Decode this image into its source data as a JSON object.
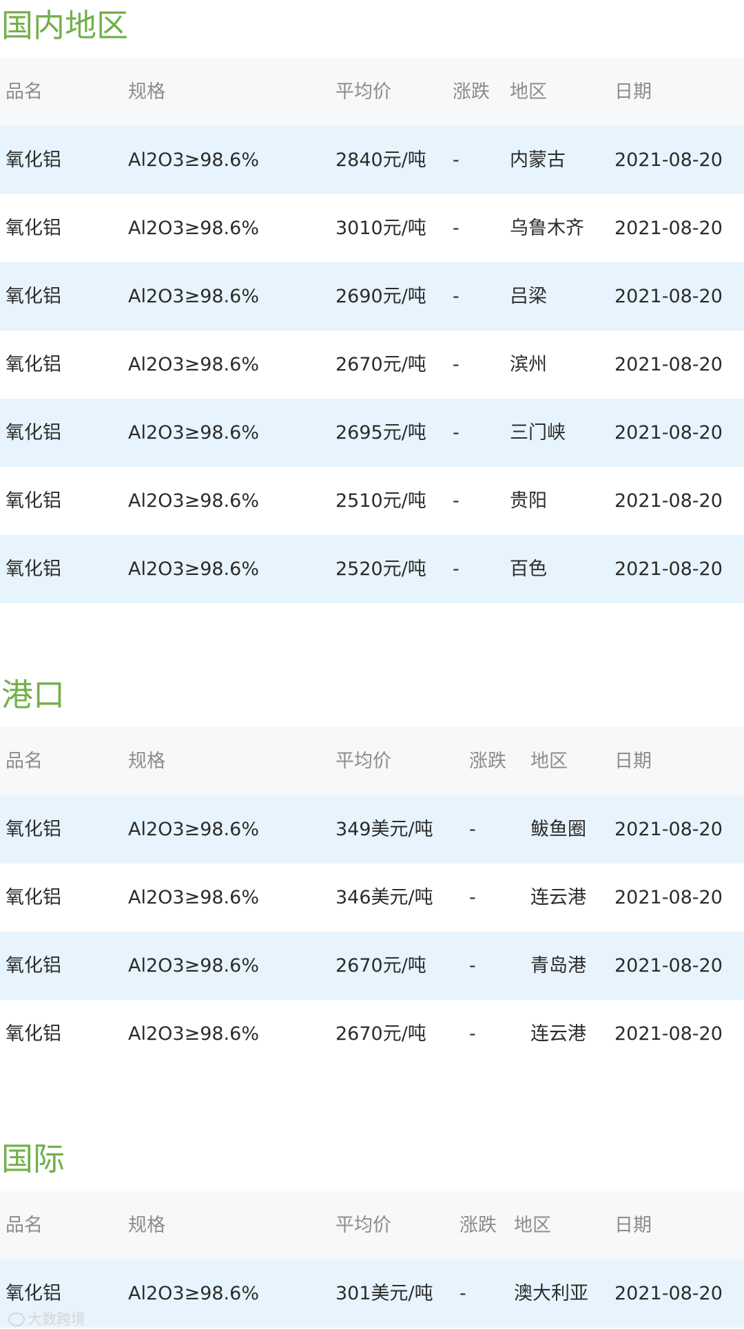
{
  "sections": [
    {
      "title": "国内地区",
      "headers": [
        "品名",
        "规格",
        "平均价",
        "涨跌",
        "地区",
        "日期"
      ],
      "rows": [
        [
          "氧化铝",
          "Al2O3≥98.6%",
          "2840元/吨",
          "-",
          "内蒙古",
          "2021-08-20"
        ],
        [
          "氧化铝",
          "Al2O3≥98.6%",
          "3010元/吨",
          "-",
          "乌鲁木齐",
          "2021-08-20"
        ],
        [
          "氧化铝",
          "Al2O3≥98.6%",
          "2690元/吨",
          "-",
          "吕梁",
          "2021-08-20"
        ],
        [
          "氧化铝",
          "Al2O3≥98.6%",
          "2670元/吨",
          "-",
          "滨州",
          "2021-08-20"
        ],
        [
          "氧化铝",
          "Al2O3≥98.6%",
          "2695元/吨",
          "-",
          "三门峡",
          "2021-08-20"
        ],
        [
          "氧化铝",
          "Al2O3≥98.6%",
          "2510元/吨",
          "-",
          "贵阳",
          "2021-08-20"
        ],
        [
          "氧化铝",
          "Al2O3≥98.6%",
          "2520元/吨",
          "-",
          "百色",
          "2021-08-20"
        ]
      ]
    },
    {
      "title": "港口",
      "headers": [
        "品名",
        "规格",
        "平均价",
        "涨跌",
        "地区",
        "日期"
      ],
      "rows": [
        [
          "氧化铝",
          "Al2O3≥98.6%",
          "349美元/吨",
          "-",
          "鲅鱼圈",
          "2021-08-20"
        ],
        [
          "氧化铝",
          "Al2O3≥98.6%",
          "346美元/吨",
          "-",
          "连云港",
          "2021-08-20"
        ],
        [
          "氧化铝",
          "Al2O3≥98.6%",
          "2670元/吨",
          "-",
          "青岛港",
          "2021-08-20"
        ],
        [
          "氧化铝",
          "Al2O3≥98.6%",
          "2670元/吨",
          "-",
          "连云港",
          "2021-08-20"
        ]
      ]
    },
    {
      "title": "国际",
      "headers": [
        "品名",
        "规格",
        "平均价",
        "涨跌",
        "地区",
        "日期"
      ],
      "rows": [
        [
          "氧化铝",
          "Al2O3≥98.6%",
          "301美元/吨",
          "-",
          "澳大利亚",
          "2021-08-20"
        ]
      ]
    }
  ],
  "watermark": "大数跨境",
  "colors": {
    "title_green": "#72b04a",
    "header_bg": "#f6f8f9",
    "stripe_blue": "#e7f4fd"
  }
}
